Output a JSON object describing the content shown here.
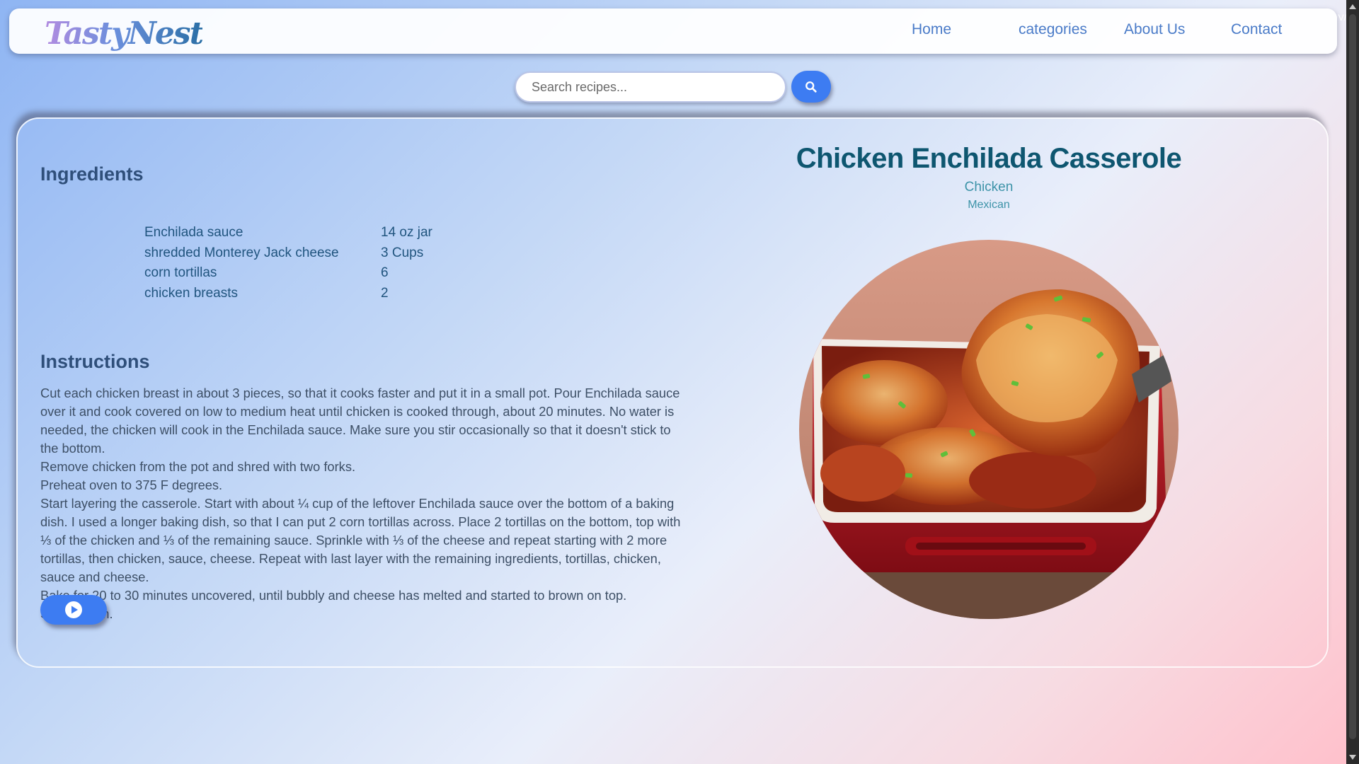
{
  "navbar": {
    "brand": "TastyNest",
    "links": [
      {
        "label": "Home"
      },
      {
        "label": "categories"
      },
      {
        "label": "About Us"
      },
      {
        "label": "Contact"
      }
    ]
  },
  "search": {
    "placeholder": "Search recipes...",
    "value": "",
    "button_icon": "search-icon"
  },
  "recipe": {
    "title": "Chicken Enchilada Casserole",
    "category": "Chicken",
    "area": "Mexican",
    "image_alt": "chicken-enchilada-casserole-photo"
  },
  "ingredients": {
    "heading": "Ingredients",
    "items": [
      {
        "name": "Enchilada sauce",
        "measure": "14 oz jar"
      },
      {
        "name": "shredded Monterey Jack cheese",
        "measure": "3 Cups"
      },
      {
        "name": "corn tortillas",
        "measure": "6"
      },
      {
        "name": "chicken breasts",
        "measure": "2"
      }
    ]
  },
  "instructions": {
    "heading": "Instructions",
    "paragraphs": [
      "Cut each chicken breast in about 3 pieces, so that it cooks faster and put it in a small pot. Pour Enchilada sauce over it and cook covered on low to medium heat until chicken is cooked through, about 20 minutes. No water is needed, the chicken will cook in the Enchilada sauce. Make sure you stir occasionally so that it doesn't stick to the bottom.",
      "Remove chicken from the pot and shred with two forks.",
      "Preheat oven to 375 F degrees.",
      "Start layering the casserole. Start with about ¼ cup of the leftover Enchilada sauce over the bottom of a baking dish. I used a longer baking dish, so that I can put 2 corn tortillas across. Place 2 tortillas on the bottom, top with ⅓ of the chicken and ⅓ of the remaining sauce. Sprinkle with ⅓ of the cheese and repeat starting with 2 more tortillas, then chicken, sauce, cheese. Repeat with last layer with the remaining ingredients, tortillas, chicken, sauce and cheese.",
      "Bake for 20 to 30 minutes uncovered, until bubbly and cheese has melted and started to brown on top.",
      "Serve warm."
    ],
    "video_button_icon": "play-icon"
  },
  "colors": {
    "accent": "#3d7cf2",
    "title": "#0e5670",
    "link": "#4a7bc8"
  }
}
